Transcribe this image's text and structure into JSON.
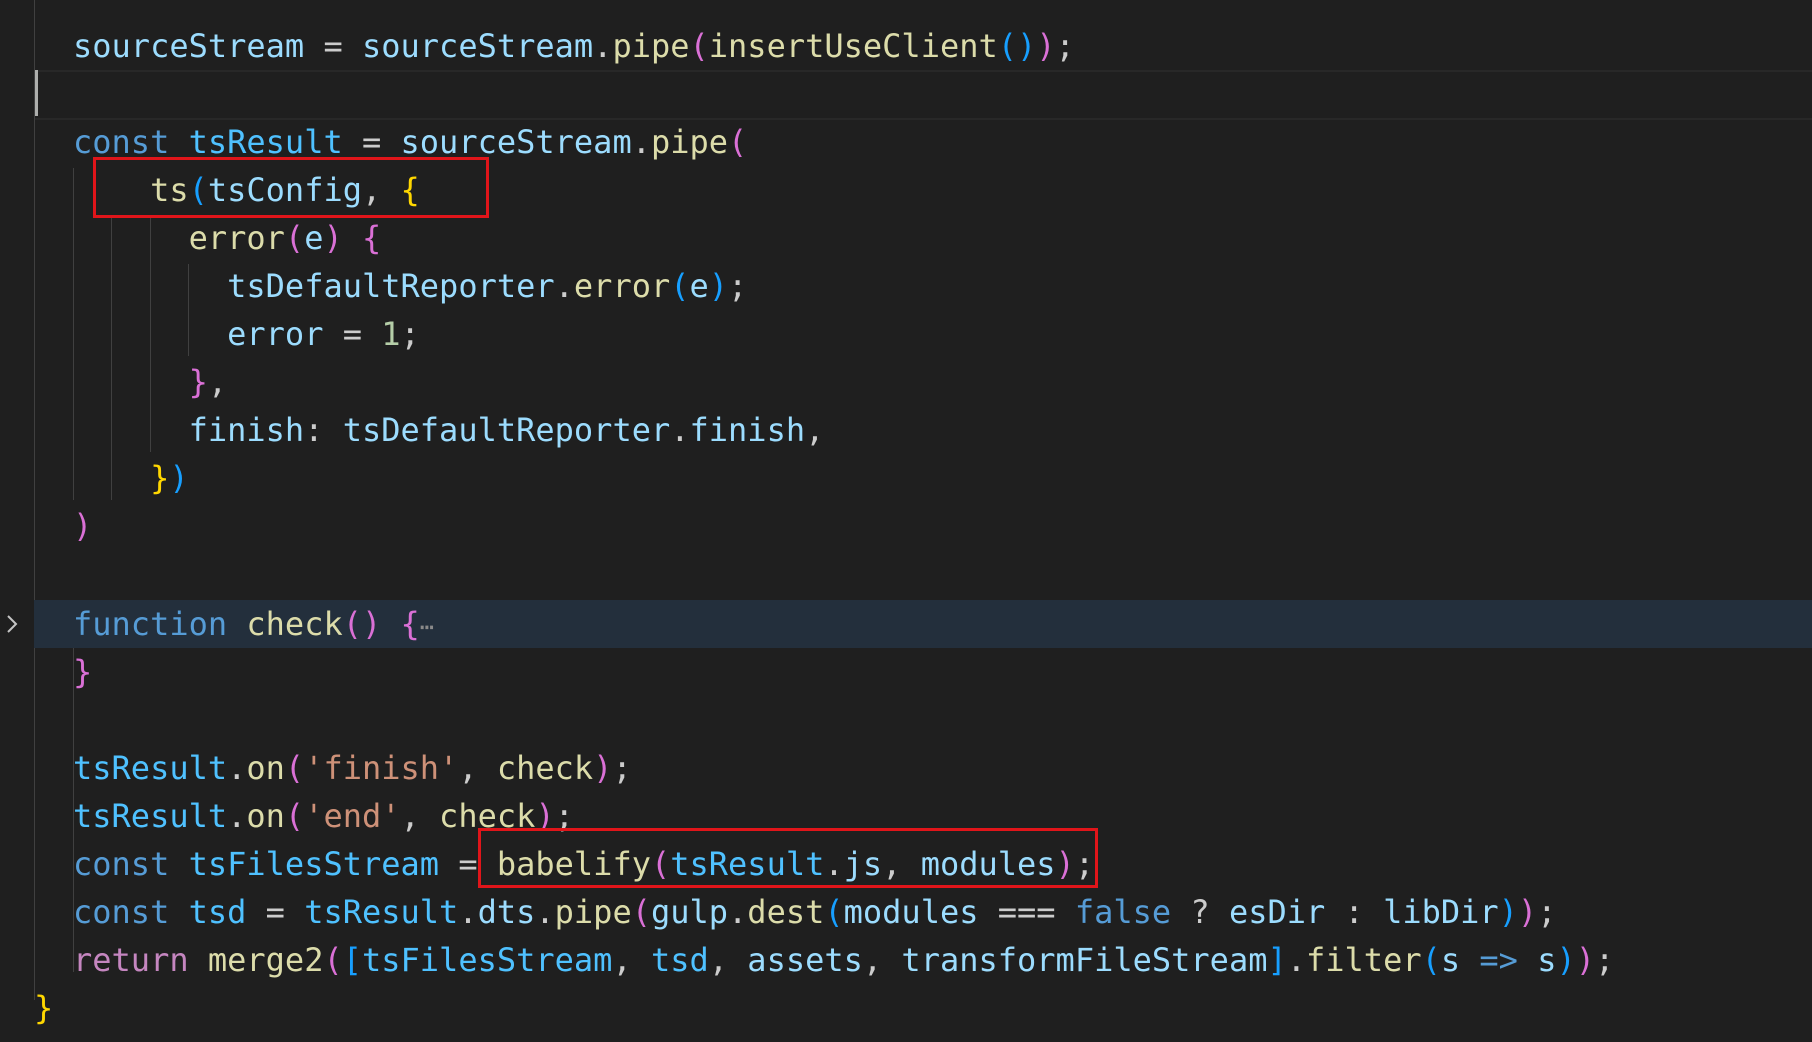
{
  "editor": {
    "lines": [
      {
        "id": "l1",
        "tokens": [
          [
            "v",
            "sourceStream"
          ],
          [
            "p",
            " = "
          ],
          [
            "v",
            "sourceStream"
          ],
          [
            "p",
            "."
          ],
          [
            "f",
            "pipe"
          ],
          [
            "b2",
            "("
          ],
          [
            "f",
            "insertUseClient"
          ],
          [
            "b3",
            "()"
          ],
          [
            "b2",
            ")"
          ],
          [
            "p",
            ";"
          ]
        ]
      },
      {
        "id": "l2",
        "tokens": []
      },
      {
        "id": "l3",
        "tokens": [
          [
            "kw",
            "const"
          ],
          [
            "p",
            " "
          ],
          [
            "c",
            "tsResult"
          ],
          [
            "p",
            " = "
          ],
          [
            "v",
            "sourceStream"
          ],
          [
            "p",
            "."
          ],
          [
            "f",
            "pipe"
          ],
          [
            "b2",
            "("
          ]
        ]
      },
      {
        "id": "l4",
        "tokens": [
          [
            "p",
            "    "
          ],
          [
            "f",
            "ts"
          ],
          [
            "b3",
            "("
          ],
          [
            "v",
            "tsConfig"
          ],
          [
            "p",
            ", "
          ],
          [
            "b1",
            "{"
          ]
        ]
      },
      {
        "id": "l5",
        "tokens": [
          [
            "p",
            "      "
          ],
          [
            "f",
            "error"
          ],
          [
            "b2",
            "("
          ],
          [
            "v",
            "e"
          ],
          [
            "b2",
            ")"
          ],
          [
            "p",
            " "
          ],
          [
            "b2",
            "{"
          ]
        ]
      },
      {
        "id": "l6",
        "tokens": [
          [
            "p",
            "        "
          ],
          [
            "v",
            "tsDefaultReporter"
          ],
          [
            "p",
            "."
          ],
          [
            "f",
            "error"
          ],
          [
            "b3",
            "("
          ],
          [
            "v",
            "e"
          ],
          [
            "b3",
            ")"
          ],
          [
            "p",
            ";"
          ]
        ]
      },
      {
        "id": "l7",
        "tokens": [
          [
            "p",
            "        "
          ],
          [
            "v",
            "error"
          ],
          [
            "p",
            " = "
          ],
          [
            "n",
            "1"
          ],
          [
            "p",
            ";"
          ]
        ]
      },
      {
        "id": "l8",
        "tokens": [
          [
            "p",
            "      "
          ],
          [
            "b2",
            "}"
          ],
          [
            "p",
            ","
          ]
        ]
      },
      {
        "id": "l9",
        "tokens": [
          [
            "p",
            "      "
          ],
          [
            "v",
            "finish"
          ],
          [
            "p",
            ": "
          ],
          [
            "v",
            "tsDefaultReporter"
          ],
          [
            "p",
            "."
          ],
          [
            "v",
            "finish"
          ],
          [
            "p",
            ","
          ]
        ]
      },
      {
        "id": "l10",
        "tokens": [
          [
            "p",
            "    "
          ],
          [
            "b1",
            "}"
          ],
          [
            "b3",
            ")"
          ]
        ]
      },
      {
        "id": "l11",
        "tokens": [
          [
            "b2",
            ")"
          ]
        ]
      },
      {
        "id": "l12",
        "tokens": []
      },
      {
        "id": "l13",
        "tokens": [
          [
            "kw",
            "function"
          ],
          [
            "p",
            " "
          ],
          [
            "f",
            "check"
          ],
          [
            "b2",
            "()"
          ],
          [
            "p",
            " "
          ],
          [
            "b2",
            "{"
          ],
          [
            "ell",
            "⋯"
          ]
        ]
      },
      {
        "id": "l14",
        "tokens": [
          [
            "b2",
            "}"
          ]
        ]
      },
      {
        "id": "l15",
        "tokens": []
      },
      {
        "id": "l16",
        "tokens": [
          [
            "c",
            "tsResult"
          ],
          [
            "p",
            "."
          ],
          [
            "f",
            "on"
          ],
          [
            "b2",
            "("
          ],
          [
            "s",
            "'finish'"
          ],
          [
            "p",
            ", "
          ],
          [
            "f",
            "check"
          ],
          [
            "b2",
            ")"
          ],
          [
            "p",
            ";"
          ]
        ]
      },
      {
        "id": "l17",
        "tokens": [
          [
            "c",
            "tsResult"
          ],
          [
            "p",
            "."
          ],
          [
            "f",
            "on"
          ],
          [
            "b2",
            "("
          ],
          [
            "s",
            "'end'"
          ],
          [
            "p",
            ", "
          ],
          [
            "f",
            "check"
          ],
          [
            "b2",
            ")"
          ],
          [
            "p",
            ";"
          ]
        ]
      },
      {
        "id": "l18",
        "tokens": [
          [
            "kw",
            "const"
          ],
          [
            "p",
            " "
          ],
          [
            "c",
            "tsFilesStream"
          ],
          [
            "p",
            " = "
          ],
          [
            "f",
            "babelify"
          ],
          [
            "b2",
            "("
          ],
          [
            "c",
            "tsResult"
          ],
          [
            "p",
            "."
          ],
          [
            "v",
            "js"
          ],
          [
            "p",
            ", "
          ],
          [
            "v",
            "modules"
          ],
          [
            "b2",
            ")"
          ],
          [
            "p",
            ";"
          ]
        ]
      },
      {
        "id": "l19",
        "tokens": [
          [
            "kw",
            "const"
          ],
          [
            "p",
            " "
          ],
          [
            "c",
            "tsd"
          ],
          [
            "p",
            " = "
          ],
          [
            "c",
            "tsResult"
          ],
          [
            "p",
            "."
          ],
          [
            "v",
            "dts"
          ],
          [
            "p",
            "."
          ],
          [
            "f",
            "pipe"
          ],
          [
            "b2",
            "("
          ],
          [
            "v",
            "gulp"
          ],
          [
            "p",
            "."
          ],
          [
            "f",
            "dest"
          ],
          [
            "b3",
            "("
          ],
          [
            "v",
            "modules"
          ],
          [
            "p",
            " === "
          ],
          [
            "kw",
            "false"
          ],
          [
            "p",
            " ? "
          ],
          [
            "v",
            "esDir"
          ],
          [
            "p",
            " : "
          ],
          [
            "v",
            "libDir"
          ],
          [
            "b3",
            ")"
          ],
          [
            "b2",
            ")"
          ],
          [
            "p",
            ";"
          ]
        ]
      },
      {
        "id": "l20",
        "tokens": [
          [
            "ctl",
            "return"
          ],
          [
            "p",
            " "
          ],
          [
            "f",
            "merge2"
          ],
          [
            "b2",
            "("
          ],
          [
            "b3",
            "["
          ],
          [
            "c",
            "tsFilesStream"
          ],
          [
            "p",
            ", "
          ],
          [
            "c",
            "tsd"
          ],
          [
            "p",
            ", "
          ],
          [
            "v",
            "assets"
          ],
          [
            "p",
            ", "
          ],
          [
            "v",
            "transformFileStream"
          ],
          [
            "b3",
            "]"
          ],
          [
            "p",
            "."
          ],
          [
            "f",
            "filter"
          ],
          [
            "b3",
            "("
          ],
          [
            "v",
            "s"
          ],
          [
            "p",
            " "
          ],
          [
            "kw",
            "=>"
          ],
          [
            "p",
            " "
          ],
          [
            "v",
            "s"
          ],
          [
            "b3",
            ")"
          ],
          [
            "b2",
            ")"
          ],
          [
            "p",
            ";"
          ]
        ]
      },
      {
        "id": "l21",
        "tokens": [
          [
            "b1",
            "}"
          ]
        ]
      }
    ]
  },
  "colors": {
    "highlight_box": "#e0151a",
    "folded_line_background": "#232f3c",
    "editor_background": "#1f1f1f"
  }
}
